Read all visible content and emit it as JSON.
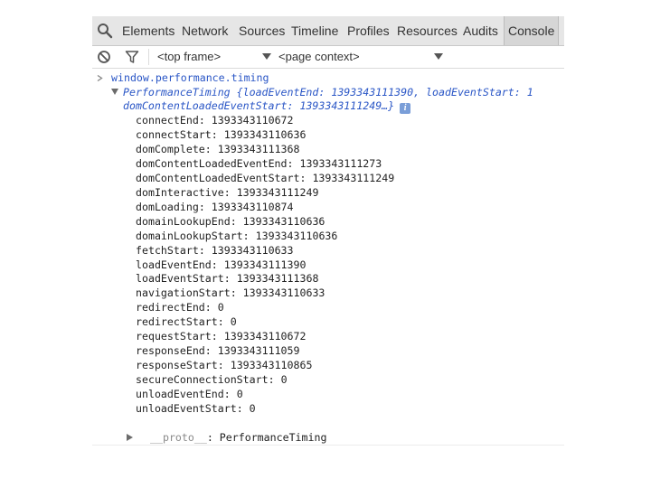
{
  "tabs": [
    {
      "label": "Elements"
    },
    {
      "label": "Network"
    },
    {
      "label": "Sources"
    },
    {
      "label": "Timeline"
    },
    {
      "label": "Profiles"
    },
    {
      "label": "Resources"
    },
    {
      "label": "Audits"
    },
    {
      "label": "Console",
      "selected": true
    }
  ],
  "toolbar": {
    "frame_select": "<top frame>",
    "context_select": "<page context>"
  },
  "console": {
    "command": "window.performance.timing",
    "object_header": "PerformanceTiming {loadEventEnd: 1393343111390, loadEventStart: 1",
    "object_header_line2": "domContentLoadedEventStart: 1393343111249…}",
    "info_icon_glyph": "i",
    "properties": [
      {
        "key": "connectEnd",
        "value": "1393343110672"
      },
      {
        "key": "connectStart",
        "value": "1393343110636"
      },
      {
        "key": "domComplete",
        "value": "1393343111368"
      },
      {
        "key": "domContentLoadedEventEnd",
        "value": "1393343111273"
      },
      {
        "key": "domContentLoadedEventStart",
        "value": "1393343111249"
      },
      {
        "key": "domInteractive",
        "value": "1393343111249"
      },
      {
        "key": "domLoading",
        "value": "1393343110874"
      },
      {
        "key": "domainLookupEnd",
        "value": "1393343110636"
      },
      {
        "key": "domainLookupStart",
        "value": "1393343110636"
      },
      {
        "key": "fetchStart",
        "value": "1393343110633"
      },
      {
        "key": "loadEventEnd",
        "value": "1393343111390"
      },
      {
        "key": "loadEventStart",
        "value": "1393343111368"
      },
      {
        "key": "navigationStart",
        "value": "1393343110633"
      },
      {
        "key": "redirectEnd",
        "value": "0"
      },
      {
        "key": "redirectStart",
        "value": "0"
      },
      {
        "key": "requestStart",
        "value": "1393343110672"
      },
      {
        "key": "responseEnd",
        "value": "1393343111059"
      },
      {
        "key": "responseStart",
        "value": "1393343110865"
      },
      {
        "key": "secureConnectionStart",
        "value": "0"
      },
      {
        "key": "unloadEventEnd",
        "value": "0"
      },
      {
        "key": "unloadEventStart",
        "value": "0"
      }
    ],
    "proto_key": "__proto__",
    "proto_value": "PerformanceTiming"
  },
  "colors": {
    "command_blue": "#2a56c6",
    "tabbar_bg": "#e6e6e6",
    "selected_tab_bg": "#d6d6d6"
  },
  "icons": {
    "search": "search-icon",
    "clear": "clear-console-icon",
    "filter": "filter-icon",
    "prompt": "chevron-right-icon",
    "expand": "triangle-down-icon",
    "collapsed": "triangle-right-icon",
    "info": "info-icon"
  }
}
